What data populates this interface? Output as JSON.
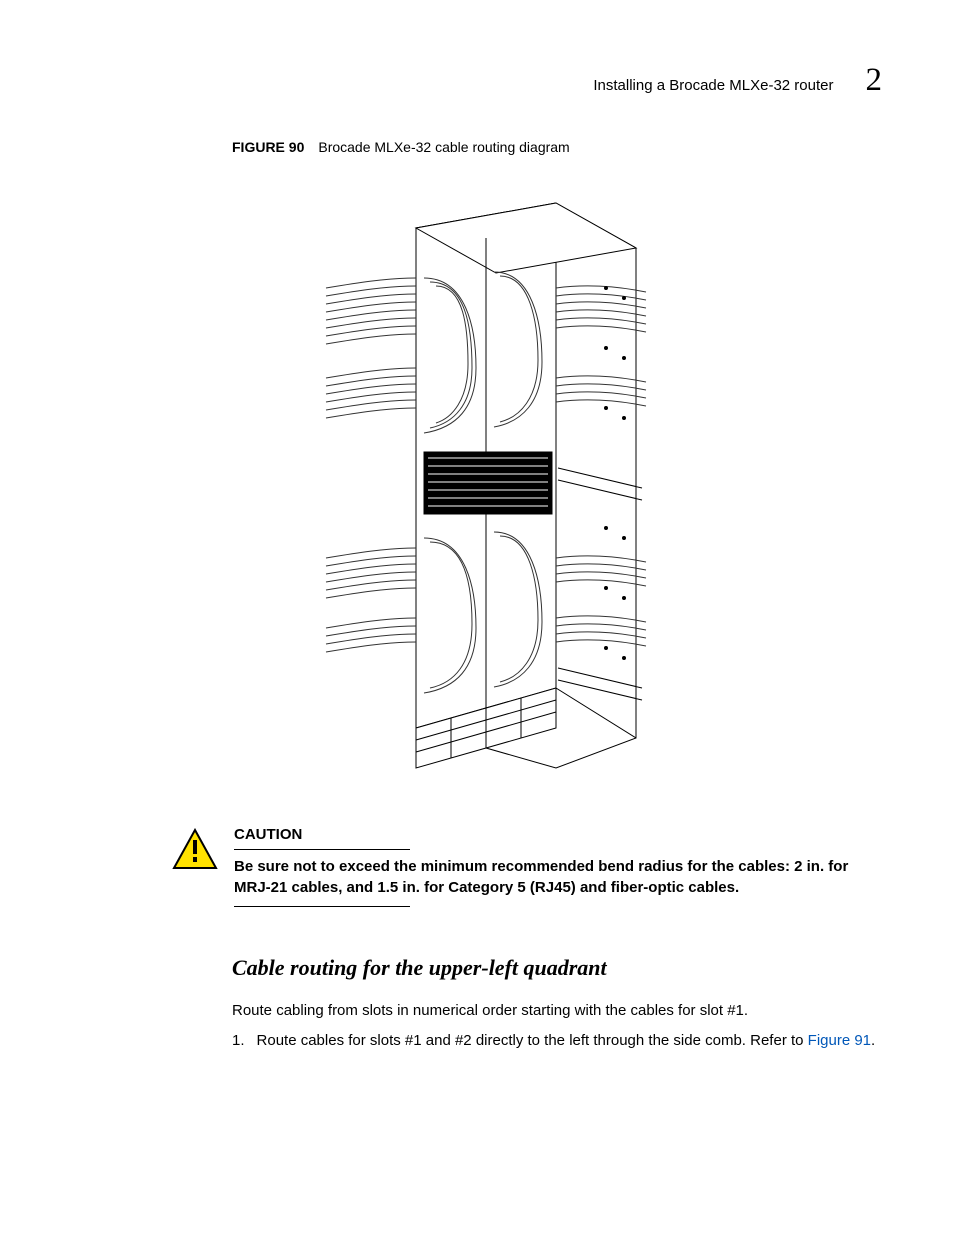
{
  "header": {
    "title": "Installing a Brocade MLXe-32 router",
    "chapter": "2"
  },
  "figure": {
    "label": "FIGURE 90",
    "caption": "Brocade MLXe-32 cable routing diagram"
  },
  "caution": {
    "title": "CAUTION",
    "text": "Be sure not to exceed the minimum recommended bend radius for the cables: 2 in. for MRJ-21 cables, and 1.5 in. for Category 5 (RJ45) and fiber-optic cables."
  },
  "section": {
    "heading": "Cable routing for the upper-left quadrant",
    "intro": "Route cabling from slots in numerical order starting with the cables for slot #1.",
    "step1_num": "1.",
    "step1_text": "Route cables for slots #1 and #2 directly to the left through the side comb. Refer to ",
    "step1_xref": "Figure 91",
    "step1_tail": "."
  }
}
